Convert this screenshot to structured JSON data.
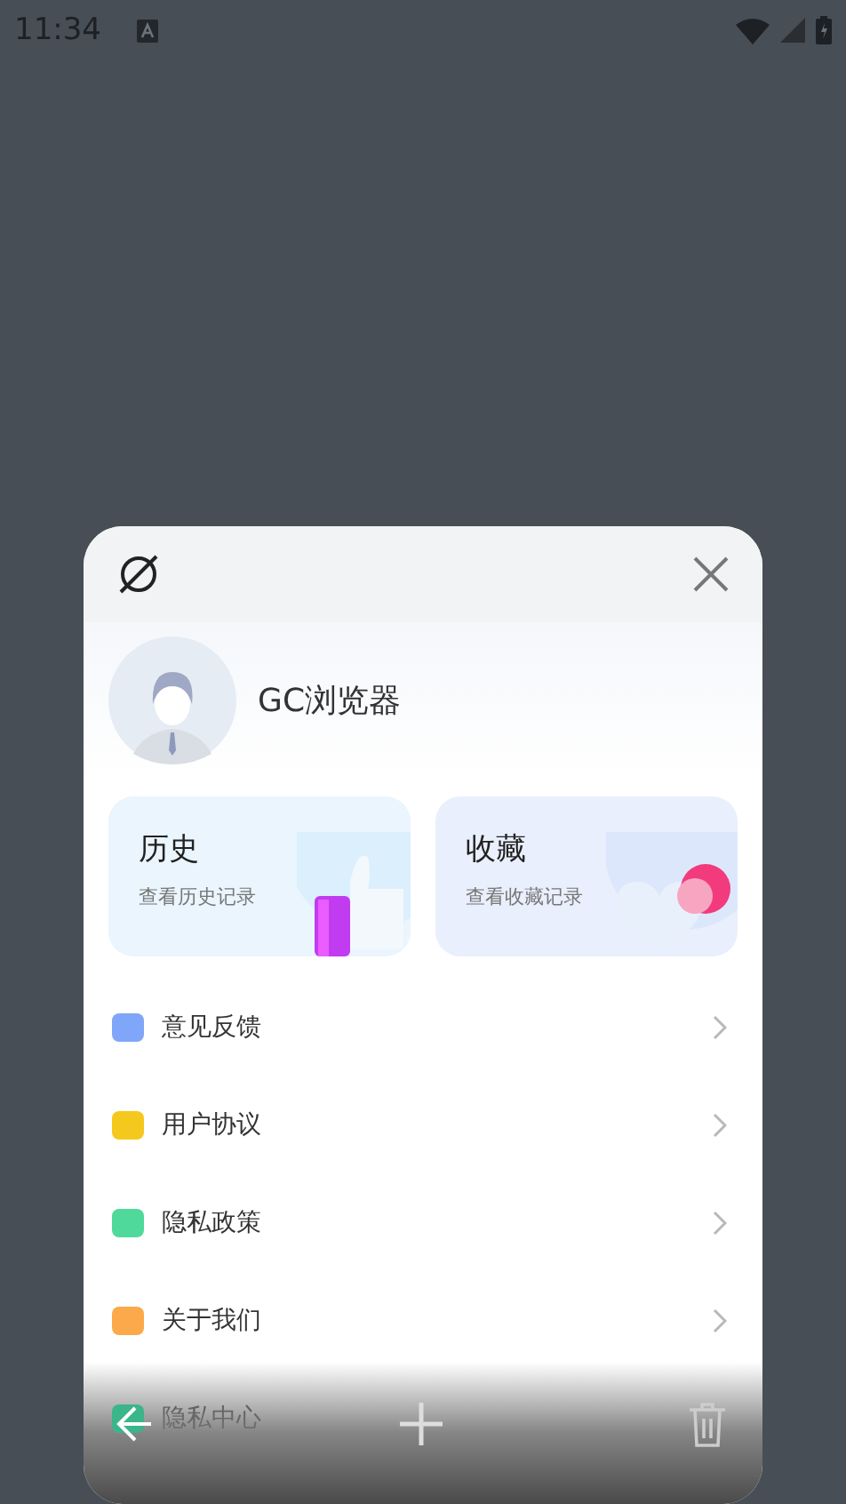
{
  "status_bar": {
    "time": "11:34"
  },
  "profile": {
    "name": "GC浏览器"
  },
  "shortcuts": [
    {
      "kind": "history",
      "title": "历史",
      "subtitle": "查看历史记录"
    },
    {
      "kind": "favorites",
      "title": "收藏",
      "subtitle": "查看收藏记录"
    }
  ],
  "menu": [
    {
      "label": "意见反馈",
      "color": "#7fa6f8",
      "chevron": true
    },
    {
      "label": "用户协议",
      "color": "#f5c81e",
      "chevron": true
    },
    {
      "label": "隐私政策",
      "color": "#4fd99a",
      "chevron": true
    },
    {
      "label": "关于我们",
      "color": "#fba94a",
      "chevron": true
    },
    {
      "label": "隐私中心",
      "color": "#3bb58a",
      "chevron": false
    }
  ]
}
